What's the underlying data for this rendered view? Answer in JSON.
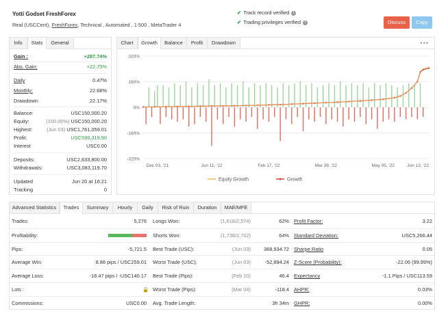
{
  "header": {
    "title": "Yotti Godset FreshForex",
    "sub_prefix": "Real (USCCent),",
    "broker": "FreshForex",
    "sub_suffix": ", Technical , Automated , 1:500 , MetaTrader 4",
    "verify1": "Track record verified",
    "verify2": "Trading privileges verified",
    "discuss": "Discuss",
    "copy": "Copy"
  },
  "left_tabs": [
    "Info",
    "Stats",
    "General"
  ],
  "left": {
    "gain_k": "Gain :",
    "gain_v": "+287.74%",
    "absgain_k": "Abs. Gain:",
    "absgain_v": "+22.75%",
    "daily_k": "Daily",
    "daily_v": "0.47%",
    "monthly_k": "Monthly:",
    "monthly_v": "22.68%",
    "drawdown_k": "Drawdown:",
    "drawdown_v": "22.17%",
    "balance_k": "Balance:",
    "balance_v": "USC150,000.20",
    "equity_k": "Equity:",
    "equity_p": "(100.00%)",
    "equity_v": "USC150,000.20",
    "highest_k": "Highest:",
    "highest_d": "(Jun 03)",
    "highest_v": "USC1,761,059.01",
    "profit_k": "Profit:",
    "profit_v": "USC599,319.90",
    "interest_k": "Interest",
    "interest_v": "USC0.00",
    "deposits_k": "Deposits:",
    "deposits_v": "USC2,633,800.00",
    "withdrawals_k": "Withdrawals:",
    "withdrawals_v": "USC3,083,119.70",
    "updated_k": "Updated",
    "updated_v": "Jun 20 at 16:21",
    "tracking_k": "Tracking",
    "tracking_v": "0"
  },
  "chart_tabs": [
    "Chart",
    "Growth",
    "Balance",
    "Profit",
    "Drawdown"
  ],
  "chart_menu": "•••",
  "chart_data": {
    "type": "line",
    "y_ticks": [
      "320%",
      "160%",
      "0%",
      "-160%",
      "-320%"
    ],
    "x_ticks": [
      "Dec 03, '21",
      "Jun 11, '22",
      "Feb 17, '22",
      "Mar 28, '22",
      "May 05, '22",
      "Jun 13, '22"
    ],
    "ylim": [
      -320,
      320
    ],
    "legend_position": "bottom",
    "legend": [
      {
        "name": "Equity Growth",
        "color": "#f0b84a"
      },
      {
        "name": "Growth",
        "color": "#d9463b"
      }
    ],
    "growth_path": [
      [
        0,
        2
      ],
      [
        4,
        3
      ],
      [
        8,
        4
      ],
      [
        12,
        5
      ],
      [
        16,
        6
      ],
      [
        20,
        7
      ],
      [
        24,
        8
      ],
      [
        28,
        9
      ],
      [
        32,
        10
      ],
      [
        36,
        11
      ],
      [
        40,
        13
      ],
      [
        44,
        15
      ],
      [
        48,
        17
      ],
      [
        52,
        20
      ],
      [
        56,
        23
      ],
      [
        60,
        26
      ],
      [
        64,
        29
      ],
      [
        68,
        32
      ],
      [
        72,
        36
      ],
      [
        76,
        40
      ],
      [
        80,
        45
      ],
      [
        84,
        50
      ],
      [
        88,
        60
      ],
      [
        90,
        70
      ],
      [
        92,
        90
      ],
      [
        94,
        120
      ],
      [
        96,
        160
      ],
      [
        97,
        220
      ],
      [
        98,
        235
      ],
      [
        100,
        245
      ]
    ],
    "bars": [
      [
        1,
        -35
      ],
      [
        2,
        50
      ],
      [
        3,
        -20
      ],
      [
        4,
        40
      ],
      [
        5,
        55
      ],
      [
        6,
        -35
      ],
      [
        7,
        55
      ],
      [
        8,
        -20
      ],
      [
        9,
        50
      ],
      [
        10,
        -25
      ],
      [
        11,
        60
      ],
      [
        12,
        -30
      ],
      [
        13,
        55
      ],
      [
        14,
        -25
      ],
      [
        15,
        65
      ],
      [
        16,
        -40
      ],
      [
        17,
        50
      ],
      [
        18,
        -35
      ],
      [
        19,
        60
      ],
      [
        20,
        -20
      ],
      [
        21,
        55
      ],
      [
        22,
        -30
      ],
      [
        23,
        70
      ],
      [
        24,
        -80
      ],
      [
        25,
        55
      ],
      [
        26,
        -25
      ],
      [
        27,
        60
      ],
      [
        28,
        -35
      ],
      [
        29,
        50
      ],
      [
        30,
        -20
      ],
      [
        31,
        60
      ],
      [
        32,
        -40
      ],
      [
        33,
        55
      ],
      [
        34,
        -25
      ],
      [
        35,
        65
      ],
      [
        36,
        -30
      ],
      [
        37,
        50
      ],
      [
        38,
        -20
      ],
      [
        39,
        60
      ],
      [
        40,
        -45
      ],
      [
        41,
        55
      ],
      [
        42,
        -25
      ],
      [
        43,
        60
      ],
      [
        44,
        -30
      ],
      [
        45,
        55
      ],
      [
        46,
        -20
      ],
      [
        47,
        50
      ],
      [
        48,
        -70
      ],
      [
        49,
        60
      ],
      [
        50,
        -25
      ],
      [
        51,
        55
      ],
      [
        52,
        -35
      ],
      [
        53,
        60
      ],
      [
        54,
        -20
      ],
      [
        55,
        65
      ],
      [
        56,
        -50
      ],
      [
        57,
        55
      ],
      [
        58,
        -25
      ],
      [
        59,
        60
      ],
      [
        60,
        -30
      ],
      [
        61,
        50
      ],
      [
        62,
        -20
      ],
      [
        63,
        55
      ],
      [
        64,
        -35
      ],
      [
        65,
        60
      ],
      [
        66,
        -25
      ],
      [
        67,
        55
      ],
      [
        68,
        -30
      ],
      [
        69,
        65
      ],
      [
        70,
        -40
      ],
      [
        71,
        55
      ],
      [
        72,
        -25
      ],
      [
        73,
        60
      ],
      [
        74,
        -30
      ],
      [
        75,
        55
      ],
      [
        76,
        -20
      ],
      [
        77,
        60
      ],
      [
        78,
        -35
      ],
      [
        79,
        50
      ],
      [
        80,
        -25
      ],
      [
        81,
        60
      ],
      [
        82,
        -45
      ],
      [
        83,
        55
      ],
      [
        84,
        -30
      ],
      [
        85,
        60
      ],
      [
        86,
        -25
      ],
      [
        87,
        55
      ],
      [
        88,
        -30
      ],
      [
        89,
        50
      ],
      [
        90,
        -20
      ],
      [
        91,
        55
      ],
      [
        92,
        -25
      ],
      [
        93,
        60
      ],
      [
        94,
        -20
      ],
      [
        95,
        55
      ],
      [
        96,
        -25
      ],
      [
        97,
        60
      ],
      [
        98,
        -20
      ]
    ]
  },
  "stats_tabs": [
    "Advanced Statistics",
    "Trades",
    "Summary",
    "Hourly",
    "Daily",
    "Risk of Ruin",
    "Duration",
    "MAE/MFE"
  ],
  "stats_rows": [
    {
      "c1k": "Trades:",
      "c1v": "5,276",
      "c2k": "Longs Won:",
      "c2d": "(1,616/2,574)",
      "c2v": "62%",
      "c3k": "Profit Factor:",
      "c3v": "3.22"
    },
    {
      "c1k": "Profitability:",
      "c1v": "",
      "c2k": "Shorts Won:",
      "c2d": "(1,738/2,702)",
      "c2v": "64%",
      "c3k": "Standard Deviation:",
      "c3v": "USC5,266.44"
    },
    {
      "c1k": "Pips:",
      "c1v": "-5,721.5",
      "c2k": "Best Trade (USC):",
      "c2d": "(Jun 03)",
      "c2v": "368,934.72",
      "c3k": "Sharpe Ratio",
      "c3v": "0.05"
    },
    {
      "c1k": "Average Win:",
      "c1v": "8.88 pips / USC259.01",
      "c2k": "Worst Trade (USC):",
      "c2d": "(Jun 03)",
      "c2v": "-52,894.24",
      "c3k": "Z-Score (Probability):",
      "c3v": "-22.06 (99.99%)"
    },
    {
      "c1k": "Average Loss:",
      "c1v": "-18.47 pips / -USC140.17",
      "c2k": "Best Trade (Pips):",
      "c2d": "(Feb 10)",
      "c2v": "46.4",
      "c3k": "Expectancy",
      "c3v": "-1.1 Pips / USC113.59"
    },
    {
      "c1k": "Lots :",
      "c1v": "",
      "c2k": "Worst Trade (Pips):",
      "c2d": "(Mar 04)",
      "c2v": "-118.4",
      "c3k": "AHPR:",
      "c3v": "0.03%"
    },
    {
      "c1k": "Commissions:",
      "c1v": "USC0.00",
      "c2k": "Avg. Trade Length:",
      "c2d": "",
      "c2v": "3h 34m",
      "c3k": "GHPR:",
      "c3v": "0.00%"
    }
  ],
  "profitability": {
    "won_fraction": 0.63,
    "won_color": "#5cb85c",
    "lost_color": "#e8746a"
  },
  "lots_icon": "lock-icon"
}
